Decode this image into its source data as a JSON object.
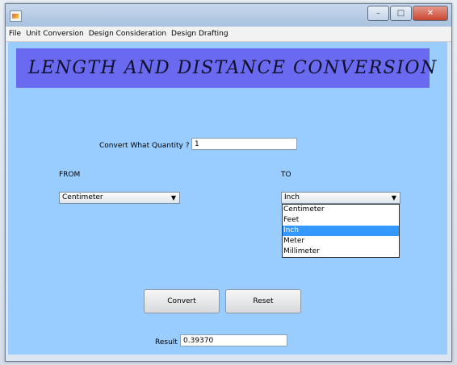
{
  "menu": [
    "File",
    "Unit Conversion",
    "Design Consideration",
    "Design Drafting"
  ],
  "banner": {
    "title": "LENGTH  AND  DISTANCE  CONVERSION"
  },
  "quantity": {
    "label": "Convert What Quantity ?",
    "value": "1"
  },
  "from": {
    "label": "FROM",
    "selected": "Centimeter"
  },
  "to": {
    "label": "TO",
    "selected": "Inch",
    "options": [
      "Centimeter",
      "Feet",
      "Inch",
      "Meter",
      "Millimeter"
    ]
  },
  "buttons": {
    "convert": "Convert",
    "reset": "Reset"
  },
  "result": {
    "label": "Result",
    "value": "0.39370"
  },
  "icons": {
    "minimize": "minimize-icon",
    "maximize": "maximize-icon",
    "close": "close-icon",
    "dropdown": "chevron-down-icon"
  }
}
